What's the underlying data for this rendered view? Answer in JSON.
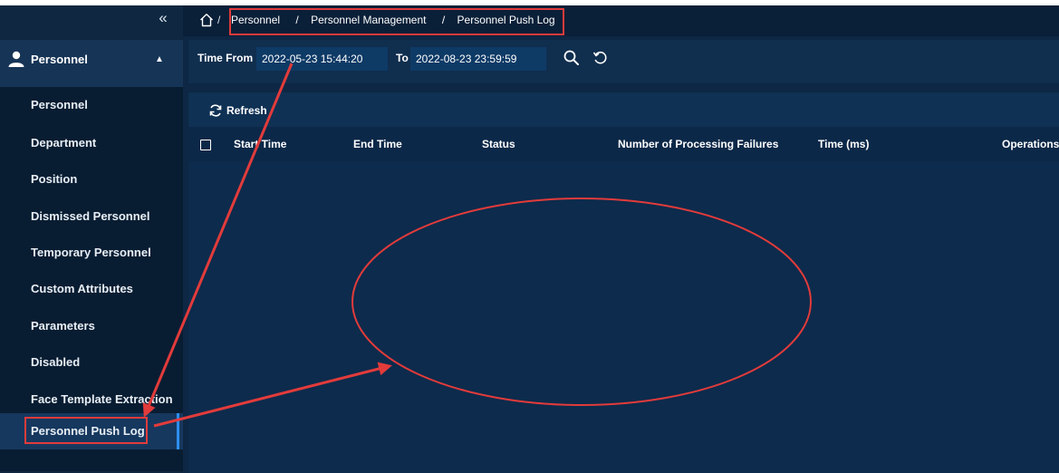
{
  "sidebar": {
    "collapse_glyph": "«",
    "group": {
      "label": "Personnel",
      "icon": "user-icon",
      "chevron": "▲"
    },
    "items": [
      {
        "label": "Personnel"
      },
      {
        "label": "Department"
      },
      {
        "label": "Position"
      },
      {
        "label": "Dismissed Personnel"
      },
      {
        "label": "Temporary Personnel"
      },
      {
        "label": "Custom Attributes"
      },
      {
        "label": "Parameters"
      },
      {
        "label": "Disabled"
      },
      {
        "label": "Face Template Extraction"
      },
      {
        "label": "Personnel Push Log"
      }
    ],
    "active_index": 9
  },
  "breadcrumb": {
    "home_icon": "home-icon",
    "separator": "/",
    "items": [
      "Personnel",
      "Personnel Management",
      "Personnel Push Log"
    ]
  },
  "filter": {
    "from_label": "Time From",
    "from_value": "2022-05-23 15:44:20",
    "to_label": "To",
    "to_value": "2022-08-23 23:59:59",
    "search_icon": "search-icon",
    "reset_icon": "reset-icon"
  },
  "toolbar": {
    "refresh_label": "Refresh",
    "refresh_icon": "refresh-icon"
  },
  "table": {
    "columns": [
      "Start Time",
      "End Time",
      "Status",
      "Number of Processing Failures",
      "Time (ms)",
      "Operations"
    ],
    "rows": []
  },
  "colors": {
    "annotation": "#e23b3b",
    "active_bar": "#2e8ff0",
    "background": "#0d2744"
  }
}
